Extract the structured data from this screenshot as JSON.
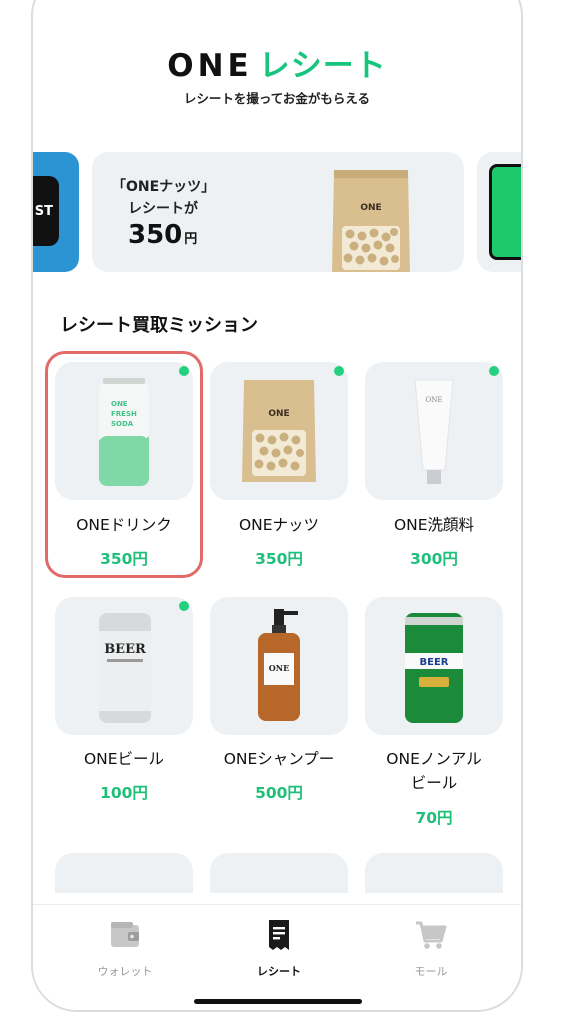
{
  "header": {
    "logo_one": "ONE",
    "logo_brand": "レシート",
    "tagline": "レシートを撮ってお金がもらえる"
  },
  "carousel": {
    "left_banner_text": "ST",
    "main_banner": {
      "line1": "「ONEナッツ」",
      "line2": "レシートが",
      "amount": "350",
      "unit": "円",
      "package_label": "ONE"
    }
  },
  "section": {
    "title": "レシート買取ミッション"
  },
  "missions": [
    {
      "name": "ONEドリンク",
      "price": "350円",
      "new": true,
      "selected": true,
      "image": "soda-can",
      "image_label": [
        "ONE",
        "FRESH",
        "SODA"
      ]
    },
    {
      "name": "ONEナッツ",
      "price": "350円",
      "new": true,
      "image": "nuts-pouch",
      "image_label": [
        "ONE"
      ]
    },
    {
      "name": "ONE洗顔料",
      "price": "300円",
      "new": true,
      "image": "face-wash-tube",
      "image_label": [
        "ONE"
      ]
    },
    {
      "name": "ONEビール",
      "price": "100円",
      "new": true,
      "image": "beer-can",
      "image_label": [
        "BEER"
      ]
    },
    {
      "name": "ONEシャンプー",
      "price": "500円",
      "new": false,
      "image": "shampoo-bottle",
      "image_label": [
        "ONE"
      ]
    },
    {
      "name_line1": "ONEノンアル",
      "name_line2": "ビール",
      "price": "70円",
      "new": false,
      "image": "nonalcohol-beer-can",
      "image_label": [
        "BEER"
      ]
    }
  ],
  "tabs": [
    {
      "label": "ウォレット",
      "icon": "wallet-icon",
      "active": false
    },
    {
      "label": "レシート",
      "icon": "receipt-icon",
      "active": true
    },
    {
      "label": "モール",
      "icon": "cart-icon",
      "active": false
    }
  ],
  "colors": {
    "accent": "#1fbf7a",
    "highlight": "#e46a6a",
    "card_bg": "#eef1f4"
  }
}
